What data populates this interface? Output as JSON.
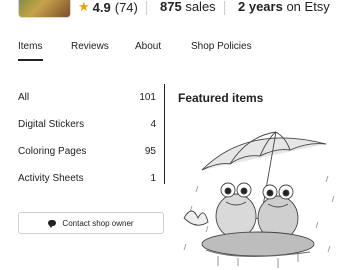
{
  "stats": {
    "rating": "4.9",
    "review_count": "(74)",
    "sales_count": "875",
    "sales_label": "sales",
    "years_count": "2 years",
    "years_label": "on Etsy"
  },
  "tabs": [
    "Items",
    "Reviews",
    "About",
    "Shop Policies"
  ],
  "categories": [
    {
      "label": "All",
      "count": "101"
    },
    {
      "label": "Digital Stickers",
      "count": "4"
    },
    {
      "label": "Coloring Pages",
      "count": "95"
    },
    {
      "label": "Activity Sheets",
      "count": "1"
    }
  ],
  "contact_button": "Contact shop owner",
  "featured": {
    "title": "Featured items"
  },
  "colors": {
    "star": "#e8a30c",
    "text": "#222222"
  }
}
